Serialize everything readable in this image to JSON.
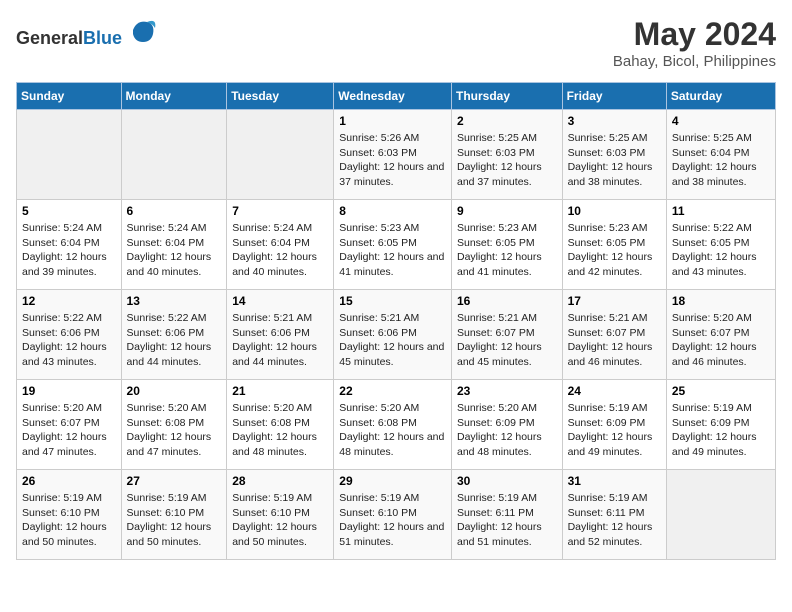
{
  "header": {
    "logo_general": "General",
    "logo_blue": "Blue",
    "month": "May 2024",
    "location": "Bahay, Bicol, Philippines"
  },
  "weekdays": [
    "Sunday",
    "Monday",
    "Tuesday",
    "Wednesday",
    "Thursday",
    "Friday",
    "Saturday"
  ],
  "weeks": [
    [
      {
        "day": "",
        "sunrise": "",
        "sunset": "",
        "daylight": ""
      },
      {
        "day": "",
        "sunrise": "",
        "sunset": "",
        "daylight": ""
      },
      {
        "day": "",
        "sunrise": "",
        "sunset": "",
        "daylight": ""
      },
      {
        "day": "1",
        "sunrise": "Sunrise: 5:26 AM",
        "sunset": "Sunset: 6:03 PM",
        "daylight": "Daylight: 12 hours and 37 minutes."
      },
      {
        "day": "2",
        "sunrise": "Sunrise: 5:25 AM",
        "sunset": "Sunset: 6:03 PM",
        "daylight": "Daylight: 12 hours and 37 minutes."
      },
      {
        "day": "3",
        "sunrise": "Sunrise: 5:25 AM",
        "sunset": "Sunset: 6:03 PM",
        "daylight": "Daylight: 12 hours and 38 minutes."
      },
      {
        "day": "4",
        "sunrise": "Sunrise: 5:25 AM",
        "sunset": "Sunset: 6:04 PM",
        "daylight": "Daylight: 12 hours and 38 minutes."
      }
    ],
    [
      {
        "day": "5",
        "sunrise": "Sunrise: 5:24 AM",
        "sunset": "Sunset: 6:04 PM",
        "daylight": "Daylight: 12 hours and 39 minutes."
      },
      {
        "day": "6",
        "sunrise": "Sunrise: 5:24 AM",
        "sunset": "Sunset: 6:04 PM",
        "daylight": "Daylight: 12 hours and 40 minutes."
      },
      {
        "day": "7",
        "sunrise": "Sunrise: 5:24 AM",
        "sunset": "Sunset: 6:04 PM",
        "daylight": "Daylight: 12 hours and 40 minutes."
      },
      {
        "day": "8",
        "sunrise": "Sunrise: 5:23 AM",
        "sunset": "Sunset: 6:05 PM",
        "daylight": "Daylight: 12 hours and 41 minutes."
      },
      {
        "day": "9",
        "sunrise": "Sunrise: 5:23 AM",
        "sunset": "Sunset: 6:05 PM",
        "daylight": "Daylight: 12 hours and 41 minutes."
      },
      {
        "day": "10",
        "sunrise": "Sunrise: 5:23 AM",
        "sunset": "Sunset: 6:05 PM",
        "daylight": "Daylight: 12 hours and 42 minutes."
      },
      {
        "day": "11",
        "sunrise": "Sunrise: 5:22 AM",
        "sunset": "Sunset: 6:05 PM",
        "daylight": "Daylight: 12 hours and 43 minutes."
      }
    ],
    [
      {
        "day": "12",
        "sunrise": "Sunrise: 5:22 AM",
        "sunset": "Sunset: 6:06 PM",
        "daylight": "Daylight: 12 hours and 43 minutes."
      },
      {
        "day": "13",
        "sunrise": "Sunrise: 5:22 AM",
        "sunset": "Sunset: 6:06 PM",
        "daylight": "Daylight: 12 hours and 44 minutes."
      },
      {
        "day": "14",
        "sunrise": "Sunrise: 5:21 AM",
        "sunset": "Sunset: 6:06 PM",
        "daylight": "Daylight: 12 hours and 44 minutes."
      },
      {
        "day": "15",
        "sunrise": "Sunrise: 5:21 AM",
        "sunset": "Sunset: 6:06 PM",
        "daylight": "Daylight: 12 hours and 45 minutes."
      },
      {
        "day": "16",
        "sunrise": "Sunrise: 5:21 AM",
        "sunset": "Sunset: 6:07 PM",
        "daylight": "Daylight: 12 hours and 45 minutes."
      },
      {
        "day": "17",
        "sunrise": "Sunrise: 5:21 AM",
        "sunset": "Sunset: 6:07 PM",
        "daylight": "Daylight: 12 hours and 46 minutes."
      },
      {
        "day": "18",
        "sunrise": "Sunrise: 5:20 AM",
        "sunset": "Sunset: 6:07 PM",
        "daylight": "Daylight: 12 hours and 46 minutes."
      }
    ],
    [
      {
        "day": "19",
        "sunrise": "Sunrise: 5:20 AM",
        "sunset": "Sunset: 6:07 PM",
        "daylight": "Daylight: 12 hours and 47 minutes."
      },
      {
        "day": "20",
        "sunrise": "Sunrise: 5:20 AM",
        "sunset": "Sunset: 6:08 PM",
        "daylight": "Daylight: 12 hours and 47 minutes."
      },
      {
        "day": "21",
        "sunrise": "Sunrise: 5:20 AM",
        "sunset": "Sunset: 6:08 PM",
        "daylight": "Daylight: 12 hours and 48 minutes."
      },
      {
        "day": "22",
        "sunrise": "Sunrise: 5:20 AM",
        "sunset": "Sunset: 6:08 PM",
        "daylight": "Daylight: 12 hours and 48 minutes."
      },
      {
        "day": "23",
        "sunrise": "Sunrise: 5:20 AM",
        "sunset": "Sunset: 6:09 PM",
        "daylight": "Daylight: 12 hours and 48 minutes."
      },
      {
        "day": "24",
        "sunrise": "Sunrise: 5:19 AM",
        "sunset": "Sunset: 6:09 PM",
        "daylight": "Daylight: 12 hours and 49 minutes."
      },
      {
        "day": "25",
        "sunrise": "Sunrise: 5:19 AM",
        "sunset": "Sunset: 6:09 PM",
        "daylight": "Daylight: 12 hours and 49 minutes."
      }
    ],
    [
      {
        "day": "26",
        "sunrise": "Sunrise: 5:19 AM",
        "sunset": "Sunset: 6:10 PM",
        "daylight": "Daylight: 12 hours and 50 minutes."
      },
      {
        "day": "27",
        "sunrise": "Sunrise: 5:19 AM",
        "sunset": "Sunset: 6:10 PM",
        "daylight": "Daylight: 12 hours and 50 minutes."
      },
      {
        "day": "28",
        "sunrise": "Sunrise: 5:19 AM",
        "sunset": "Sunset: 6:10 PM",
        "daylight": "Daylight: 12 hours and 50 minutes."
      },
      {
        "day": "29",
        "sunrise": "Sunrise: 5:19 AM",
        "sunset": "Sunset: 6:10 PM",
        "daylight": "Daylight: 12 hours and 51 minutes."
      },
      {
        "day": "30",
        "sunrise": "Sunrise: 5:19 AM",
        "sunset": "Sunset: 6:11 PM",
        "daylight": "Daylight: 12 hours and 51 minutes."
      },
      {
        "day": "31",
        "sunrise": "Sunrise: 5:19 AM",
        "sunset": "Sunset: 6:11 PM",
        "daylight": "Daylight: 12 hours and 52 minutes."
      },
      {
        "day": "",
        "sunrise": "",
        "sunset": "",
        "daylight": ""
      }
    ]
  ]
}
